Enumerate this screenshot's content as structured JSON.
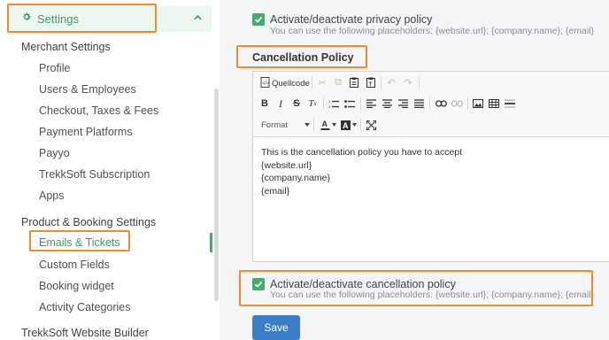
{
  "sidebar": {
    "settings_label": "Settings",
    "sections": [
      {
        "title": "Merchant Settings",
        "items": [
          "Profile",
          "Users & Employees",
          "Checkout, Taxes & Fees",
          "Payment Platforms",
          "Payyo",
          "TrekkSoft Subscription",
          "Apps"
        ]
      },
      {
        "title": "Product & Booking Settings",
        "items": [
          "Emails & Tickets",
          "Custom Fields",
          "Booking widget",
          "Activity Categories"
        ]
      },
      {
        "title": "TrekkSoft Website Builder",
        "items": []
      }
    ],
    "active_item": "Emails & Tickets"
  },
  "privacy": {
    "checkbox_label": "Activate/deactivate privacy policy",
    "hint": "You can use the following placeholders: {website.url}; {company.name}; {email}",
    "checked": true
  },
  "cancellation": {
    "heading": "Cancellation Policy",
    "editor": {
      "source_label": "Quellcode",
      "format_label": "Format",
      "content_lines": [
        "This is the cancellation policy you have to accept",
        "{website.url}",
        "{company.name}",
        "{email}"
      ]
    },
    "checkbox_label": "Activate/deactivate cancellation policy",
    "hint": "You can use the following placeholders: {website.url}; {company.name}; {email}",
    "checked": true
  },
  "save_label": "Save",
  "colors": {
    "accent_green": "#3fae6e",
    "highlight_orange": "#f08a2e",
    "save_blue": "#3b7ec8"
  }
}
